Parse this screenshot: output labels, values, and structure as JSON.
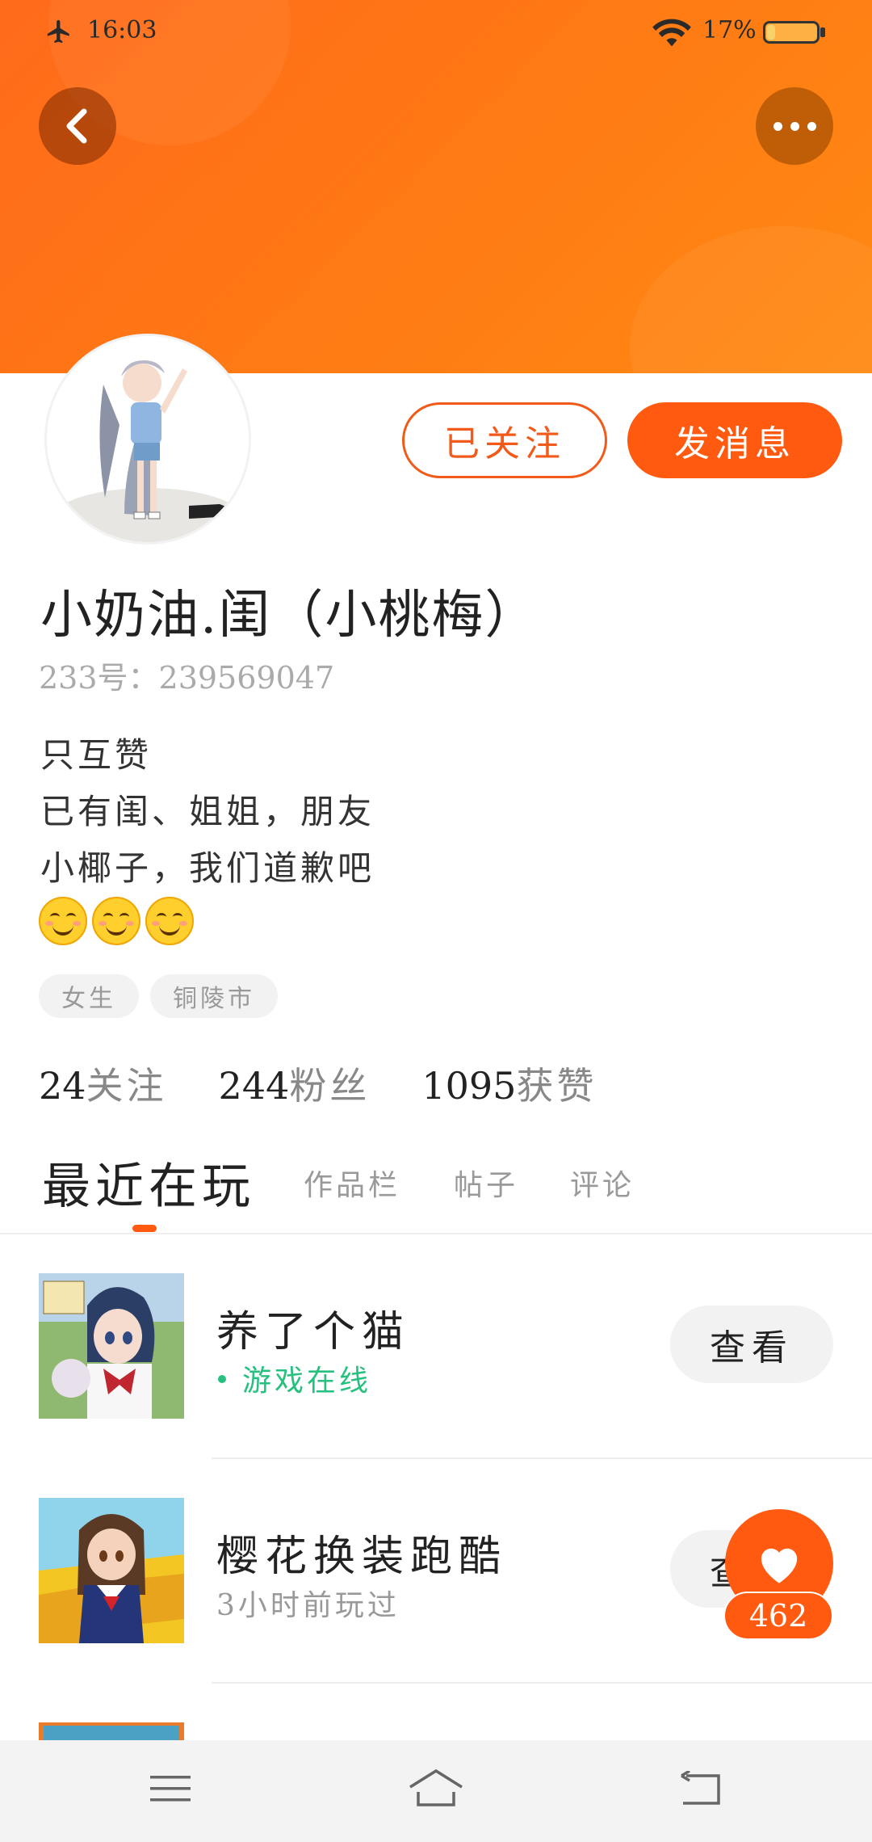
{
  "status_bar": {
    "time": "16:03",
    "battery_pct": "17%",
    "battery_level": 0.17,
    "icons": [
      "airplane-mode-icon",
      "wifi-icon",
      "battery-icon"
    ]
  },
  "header": {
    "back_icon": "chevron-left-icon",
    "more_icon": "more-dots-icon"
  },
  "profile": {
    "follow_button": "已关注",
    "message_button": "发消息",
    "username": "小奶油.闺（小桃梅）",
    "uid": "233号：239569047",
    "bio_lines": [
      "只互赞",
      "已有闺、姐姐，朋友",
      "小椰子，我们道歉吧"
    ],
    "emojis": [
      "smiling-face-icon",
      "smiling-face-icon",
      "smiling-face-icon"
    ],
    "tags": [
      "女生",
      "铜陵市"
    ],
    "stats": [
      {
        "value": "24",
        "label": "关注"
      },
      {
        "value": "244",
        "label": "粉丝"
      },
      {
        "value": "1095",
        "label": "获赞"
      }
    ]
  },
  "tabs": [
    {
      "label": "最近在玩",
      "active": true
    },
    {
      "label": "作品栏",
      "active": false
    },
    {
      "label": "帖子",
      "active": false
    },
    {
      "label": "评论",
      "active": false
    }
  ],
  "games": [
    {
      "name": "养了个猫",
      "status": "游戏在线",
      "online": true,
      "action": "查看"
    },
    {
      "name": "樱花换装跑酷",
      "status": "3小时前玩过",
      "online": false,
      "action": "查看"
    }
  ],
  "like_float": {
    "count": "462",
    "icon": "heart-icon"
  },
  "nav_bar": {
    "icons": [
      "menu-icon",
      "home-icon",
      "back-icon"
    ]
  },
  "colors": {
    "accent": "#ff5a10",
    "online": "#27c07f",
    "banner": "#ff7b14"
  }
}
